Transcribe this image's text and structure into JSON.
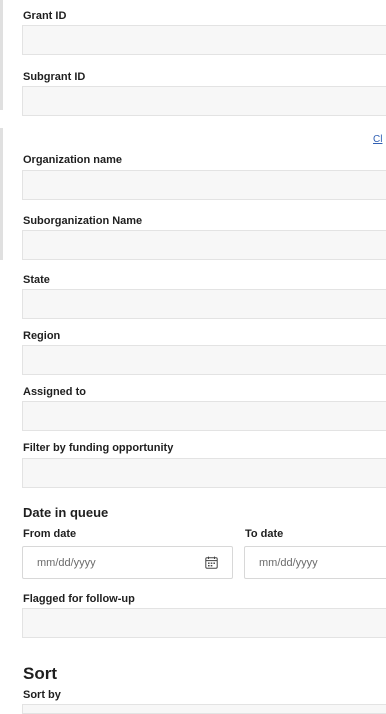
{
  "filters": {
    "grant_id_label": "Grant ID",
    "subgrant_id_label": "Subgrant ID",
    "clear_link": "Cl",
    "organization_name_label": "Organization name",
    "suborganization_name_label": "Suborganization Name",
    "state_label": "State",
    "region_label": "Region",
    "assigned_to_label": "Assigned to",
    "funding_opportunity_label": "Filter by funding opportunity",
    "date_in_queue_title": "Date in queue",
    "from_date_label": "From date",
    "to_date_label": "To date",
    "from_date_placeholder": "mm/dd/yyyy",
    "to_date_placeholder": "mm/dd/yyyy",
    "flagged_label": "Flagged for follow-up"
  },
  "sort": {
    "title": "Sort",
    "sort_by_label": "Sort by"
  },
  "icons": {
    "calendar": "calendar-icon"
  },
  "colors": {
    "link": "#2f5fb3",
    "field_bg": "#f7f7f7"
  }
}
